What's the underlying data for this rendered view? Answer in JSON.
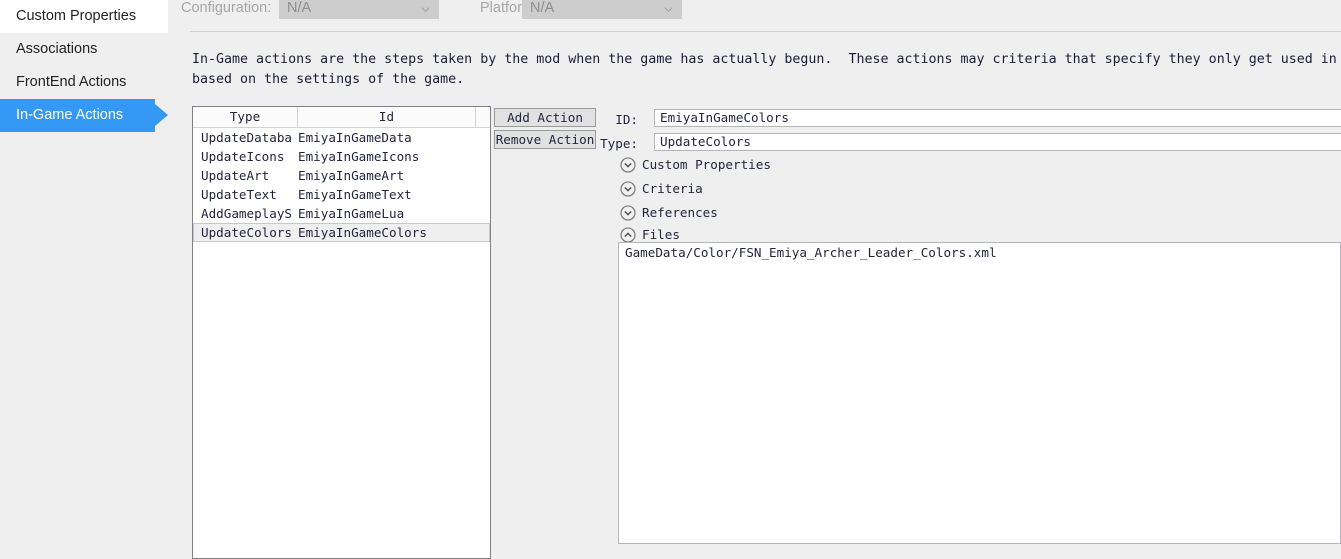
{
  "sidebar": {
    "items": [
      {
        "label": "Custom Properties",
        "state": "hover"
      },
      {
        "label": "Associations",
        "state": "normal"
      },
      {
        "label": "FrontEnd Actions",
        "state": "normal"
      },
      {
        "label": "In-Game Actions",
        "state": "selected"
      }
    ]
  },
  "toolbar": {
    "configuration_label": "Configuration:",
    "configuration_value": "N/A",
    "platform_label": "Platform:",
    "platform_value": "N/A"
  },
  "description": {
    "line1": "In-Game actions are the steps taken by the mod when the game has actually begun.  These actions may criteria that specify they only get used in",
    "line2": "based on the settings of the game."
  },
  "action_list": {
    "columns": [
      "Type",
      "Id",
      ""
    ],
    "rows": [
      {
        "type": "UpdateDatabase",
        "id": "EmiyaInGameData",
        "selected": false
      },
      {
        "type": "UpdateIcons",
        "id": "EmiyaInGameIcons",
        "selected": false
      },
      {
        "type": "UpdateArt",
        "id": "EmiyaInGameArt",
        "selected": false
      },
      {
        "type": "UpdateText",
        "id": "EmiyaInGameText",
        "selected": false
      },
      {
        "type": "AddGameplayScri",
        "id": "EmiyaInGameLua",
        "selected": false
      },
      {
        "type": "UpdateColors",
        "id": "EmiyaInGameColors",
        "selected": true
      }
    ]
  },
  "buttons": {
    "add_action": "Add Action",
    "remove_action": "Remove Action"
  },
  "details": {
    "id_label": "ID:",
    "id_value": "EmiyaInGameColors",
    "type_label": "Type:",
    "type_value": "UpdateColors",
    "sections": [
      {
        "label": "Custom Properties",
        "expanded": false
      },
      {
        "label": "Criteria",
        "expanded": false
      },
      {
        "label": "References",
        "expanded": false
      },
      {
        "label": "Files",
        "expanded": true
      }
    ],
    "files": [
      "GameData/Color/FSN_Emiya_Archer_Leader_Colors.xml"
    ]
  },
  "colors": {
    "accent": "#3399f5",
    "panel_bg": "#efefef",
    "field_bg": "#ffffff",
    "text": "#24243f"
  }
}
